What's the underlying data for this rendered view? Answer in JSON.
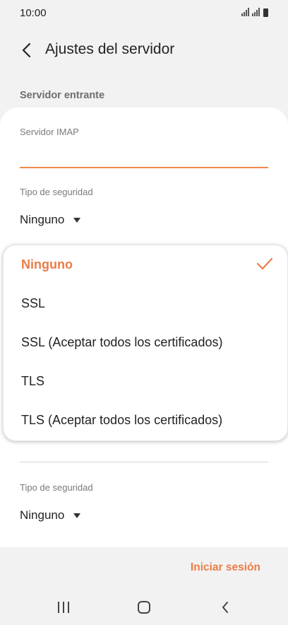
{
  "status_bar": {
    "time": "10:00",
    "signal_icons": "signal-icon"
  },
  "header": {
    "title": "Ajustes del servidor",
    "back_icon": "back-arrow-icon"
  },
  "section": {
    "label": "Servidor entrante"
  },
  "form": {
    "imap_label": "Servidor IMAP",
    "imap_value": "",
    "security_label_1": "Tipo de seguridad",
    "security_value_1": "Ninguno",
    "security_label_2": "Tipo de seguridad",
    "security_value_2": "Ninguno"
  },
  "dropdown": {
    "options": [
      {
        "label": "Ninguno",
        "selected": true
      },
      {
        "label": "SSL",
        "selected": false
      },
      {
        "label": "SSL (Aceptar todos los certificados)",
        "selected": false
      },
      {
        "label": "TLS",
        "selected": false
      },
      {
        "label": "TLS (Aceptar todos los certificados)",
        "selected": false
      }
    ]
  },
  "footer": {
    "signin_label": "Iniciar sesión"
  },
  "colors": {
    "accent": "#ea7d47",
    "background": "#f2f2f2",
    "card": "#ffffff"
  },
  "nav_icons": [
    "recent-apps-icon",
    "home-icon",
    "back-icon"
  ]
}
